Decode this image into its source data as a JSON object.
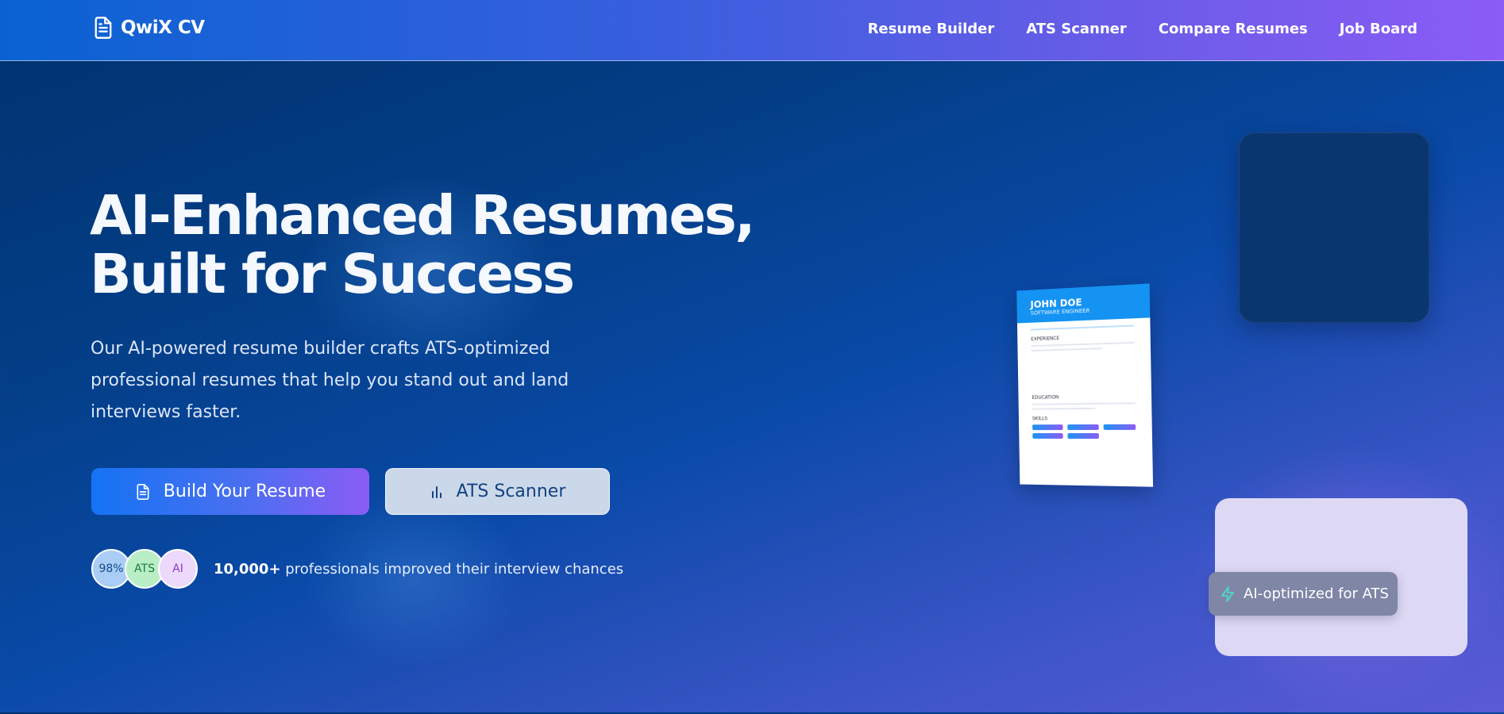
{
  "brand": {
    "name": "QwiX CV",
    "icon": "document-icon"
  },
  "nav": {
    "links": [
      "Resume Builder",
      "ATS Scanner",
      "Compare Resumes",
      "Job Board"
    ]
  },
  "hero": {
    "title_line1": "AI-Enhanced Resumes,",
    "title_line2": "Built for Success",
    "description": "Our AI-powered resume builder crafts ATS-optimized professional resumes that help you stand out and land interviews faster.",
    "primary_button": {
      "label": "Build Your Resume",
      "icon": "document-icon"
    },
    "secondary_button": {
      "label": "ATS Scanner",
      "icon": "bar-chart-icon"
    }
  },
  "social_proof": {
    "badges": [
      "98%",
      "ATS",
      "AI"
    ],
    "count": "10,000+",
    "text": " professionals improved their interview chances"
  },
  "resume_preview": {
    "name": "JOHN DOE",
    "role": "SOFTWARE ENGINEER",
    "sections": [
      "EXPERIENCE",
      "EDUCATION",
      "SKILLS"
    ]
  },
  "ai_pill": {
    "label": "AI-optimized for ATS",
    "icon": "lightning-icon"
  },
  "colors": {
    "accent_blue": "#1673f5",
    "accent_purple": "#8b5cf6",
    "background_dark": "#00316d"
  }
}
